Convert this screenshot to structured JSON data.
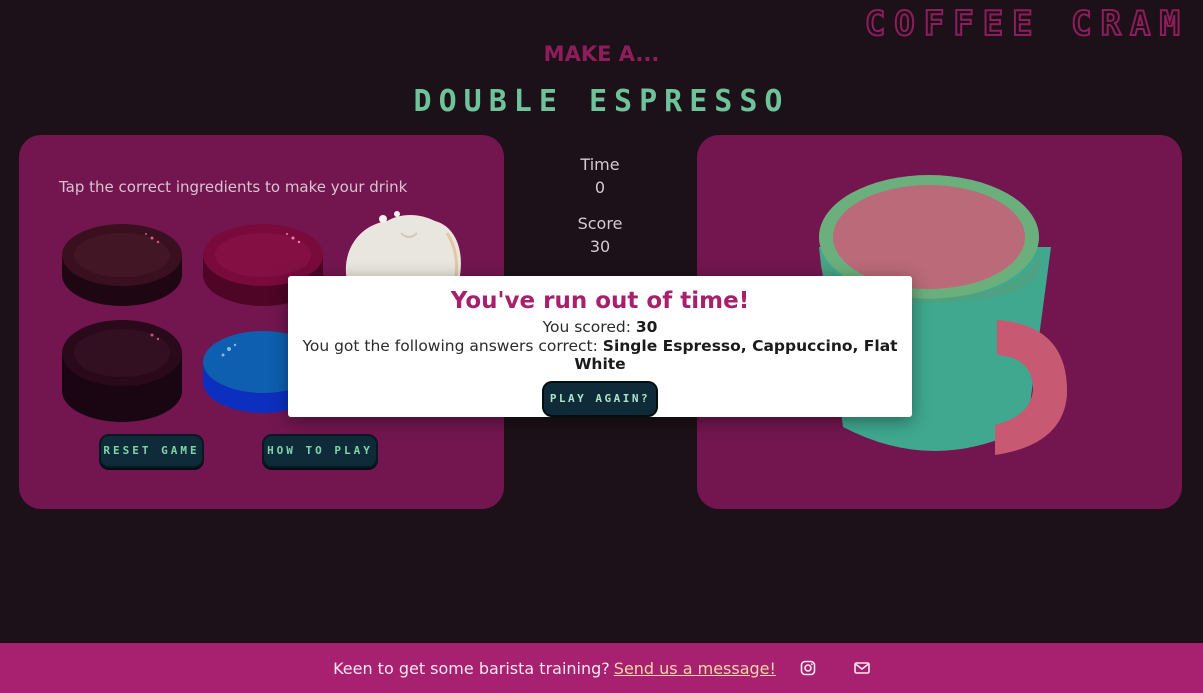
{
  "brand": "COFFEE CRAM",
  "prompt": "MAKE A...",
  "drink_name": "DOUBLE ESPRESSO",
  "instructions": "Tap the correct ingredients to make your drink",
  "ingredients": [
    {
      "name": "dark-roast-bean-icon",
      "color": "#3a1020"
    },
    {
      "name": "red-bean-icon",
      "color": "#7a0a3c"
    },
    {
      "name": "milk-foam-icon",
      "color": "#e9e5df"
    },
    {
      "name": "dark-bean-icon",
      "color": "#2a0a1a"
    },
    {
      "name": "blue-bean-icon",
      "color": "#0e5fb0"
    }
  ],
  "buttons": {
    "reset": "RESET GAME",
    "how_to_play": "HOW TO PLAY"
  },
  "stats": {
    "time_label": "Time",
    "time_value": "0",
    "score_label": "Score",
    "score_value": "30"
  },
  "modal": {
    "title": "You've run out of time!",
    "scored_label": "You scored: ",
    "scored_value": "30",
    "answers_label": "You got the following answers correct: ",
    "answers_value": "Single Espresso, Cappuccino, Flat White",
    "play_again": "PLAY AGAIN?"
  },
  "footer": {
    "text": "Keen to get some barista training?",
    "link": "Send us a message!",
    "icons": [
      "instagram-icon",
      "mail-icon"
    ]
  },
  "colors": {
    "background": "#1c1118",
    "panel": "#731650",
    "accent": "#a82070",
    "green": "#6fc39a"
  }
}
